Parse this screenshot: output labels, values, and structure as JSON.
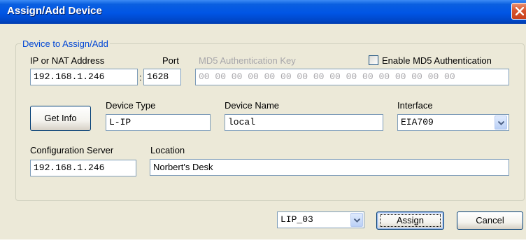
{
  "window": {
    "title": "Assign/Add Device"
  },
  "group": {
    "legend": "Device to Assign/Add"
  },
  "labels": {
    "ip_address": "IP or NAT Address",
    "port": "Port",
    "md5_key": "MD5 Authentication Key",
    "enable_md5": "Enable MD5 Authentication",
    "device_type": "Device Type",
    "device_name": "Device Name",
    "interface": "Interface",
    "config_server": "Configuration Server",
    "location": "Location"
  },
  "fields": {
    "ip_address": "192.168.1.246",
    "port_separator": ":",
    "port": "1628",
    "md5_key": "00 00 00 00 00 00 00 00 00 00 00 00 00 00 00 00",
    "device_type": "L-IP",
    "device_name": "local",
    "interface": "EIA709",
    "config_server": "192.168.1.246",
    "location": "Norbert's Desk"
  },
  "checkbox": {
    "enable_md5_checked": false
  },
  "buttons": {
    "get_info": "Get Info",
    "assign": "Assign",
    "cancel": "Cancel"
  },
  "bottom": {
    "selector_value": "LIP_03"
  }
}
